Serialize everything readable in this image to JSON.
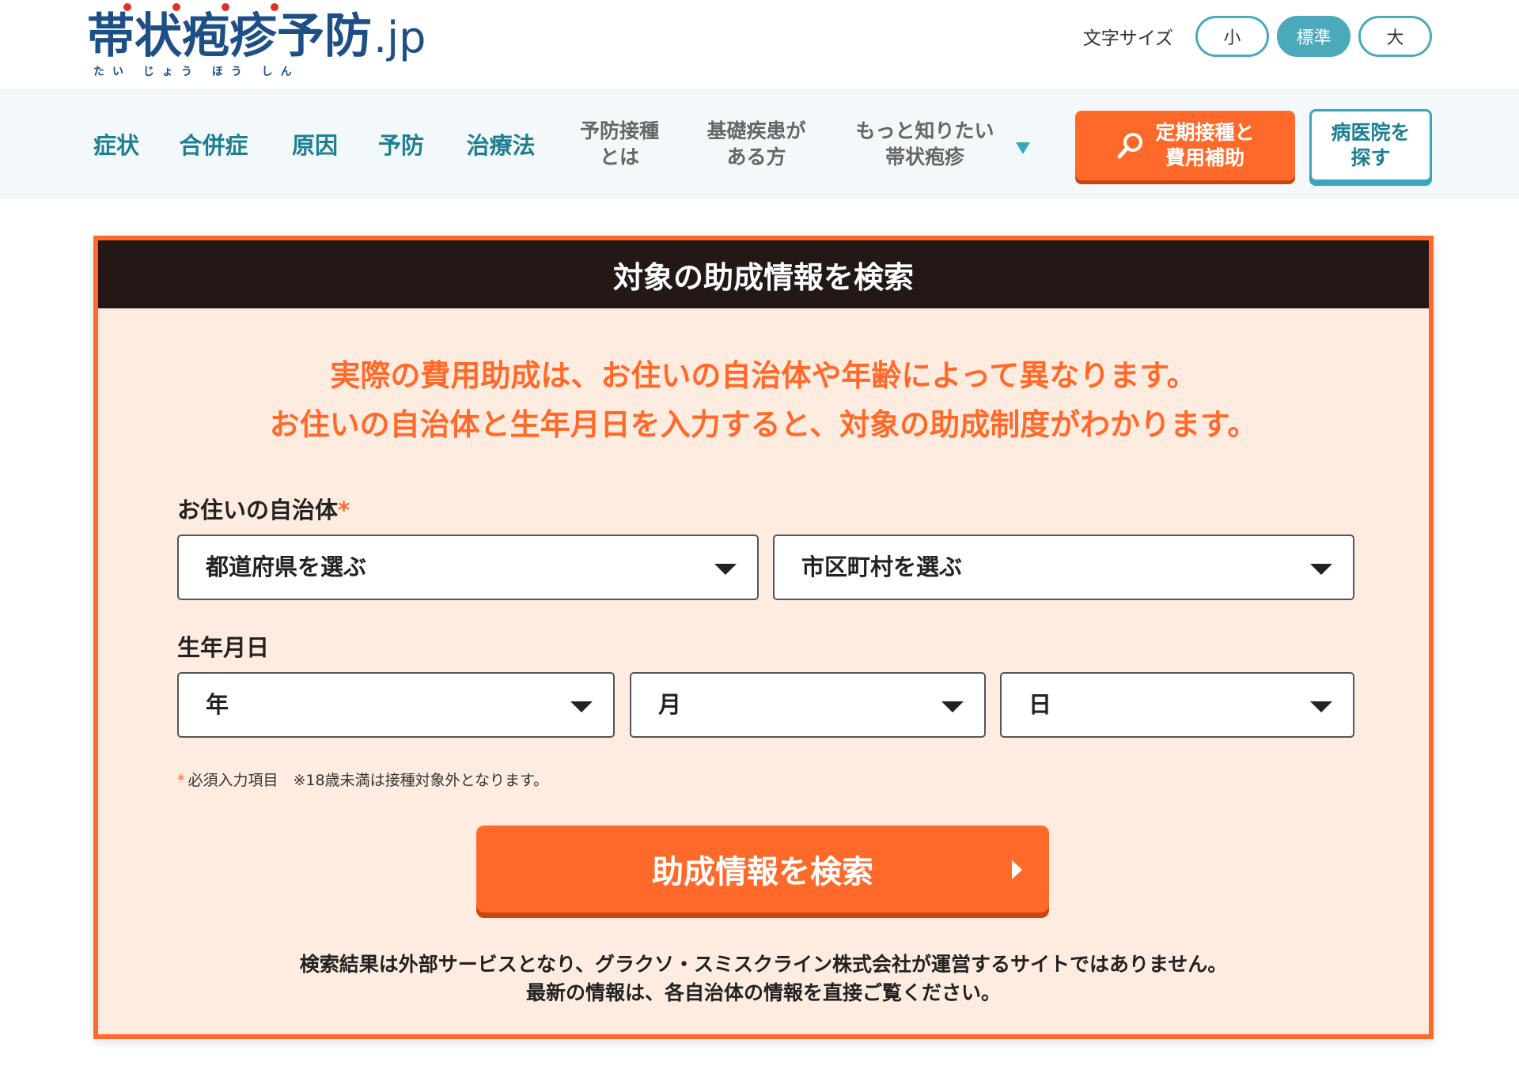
{
  "logo": {
    "text": "帯状疱疹予防",
    "suffix": ".jp",
    "ruby": "たい じょう ほう しん",
    "accent_color": "#e0302a"
  },
  "font_size": {
    "label": "文字サイズ",
    "options": [
      "小",
      "標準",
      "大"
    ],
    "selected": "標準"
  },
  "nav": {
    "items": [
      "症状",
      "合併症",
      "原因",
      "予防",
      "治療法",
      "予防接種\nとは",
      "基礎疾患が\nある方",
      "もっと知りたい\n帯状疱疹"
    ],
    "dropdown_icon": "triangle-down-icon",
    "cta_subsidy": "定期接種と\n費用補助",
    "cta_subsidy_icon": "search-icon",
    "cta_hospital": "病医院を\n探す"
  },
  "search": {
    "title": "対象の助成情報を検索",
    "intro_line1": "実際の費用助成は、お住いの自治体や年齢によって異なります。",
    "intro_line2": "お住いの自治体と生年月日を入力すると、対象の助成制度がわかります。",
    "municipality_label": "お住いの自治体",
    "required_mark": "*",
    "prefecture_placeholder": "都道府県を選ぶ",
    "city_placeholder": "市区町村を選ぶ",
    "birthdate_label": "生年月日",
    "year_placeholder": "年",
    "month_placeholder": "月",
    "day_placeholder": "日",
    "note": "必須入力項目　※18歳未満は接種対象外となります。",
    "button_label": "助成情報を検索",
    "disclaimer_line1": "検索結果は外部サービスとなり、グラクソ・スミスクライン株式会社が運営するサイトではありません。",
    "disclaimer_line2": "最新の情報は、各自治体の情報を直接ご覧ください。"
  },
  "colors": {
    "brand_orange": "#ff6a2b",
    "brand_teal": "#3aa6bd",
    "panel_bg": "#ffece1",
    "header_dark": "#231815"
  }
}
